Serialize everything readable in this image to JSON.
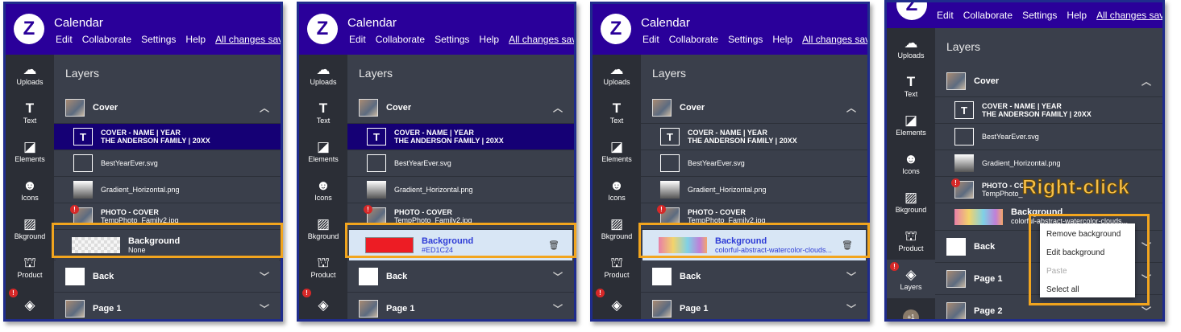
{
  "app": {
    "title": "Calendar",
    "logo": "Z",
    "menu": [
      "Edit",
      "Collaborate",
      "Settings",
      "Help"
    ],
    "saved": "All changes sav",
    "saved_full": "All changes saved"
  },
  "sidebar": [
    {
      "label": "Uploads",
      "icon": "cloud-upload-icon"
    },
    {
      "label": "Text",
      "icon": "text-icon"
    },
    {
      "label": "Elements",
      "icon": "elements-icon"
    },
    {
      "label": "Icons",
      "icon": "smiley-icon"
    },
    {
      "label": "Bkground",
      "icon": "hatch-icon"
    },
    {
      "label": "Product",
      "icon": "product-icon"
    },
    {
      "label": "Layers",
      "icon": "layers-icon"
    }
  ],
  "layers": {
    "heading": "Layers",
    "cover": "Cover",
    "text_layer": {
      "line1": "COVER - NAME | YEAR",
      "line2": "THE ANDERSON FAMILY | 20XX"
    },
    "svg_layer": "BestYearEver.svg",
    "gradient_layer": "Gradient_Horizontal.png",
    "photo_layer": {
      "line1": "PHOTO - COVER",
      "line2": "TempPhoto_Family2.jpg"
    },
    "photo_layer_p4": {
      "line1": "PHOTO - CO",
      "line2": "TempPhoto_"
    },
    "back": "Back",
    "page1": "Page 1",
    "page2": "Page 2"
  },
  "backgrounds": [
    {
      "label": "Background",
      "sub": "None",
      "color": "#3a3f4b"
    },
    {
      "label": "Background",
      "sub": "#ED1C24",
      "color": "#ED1C24"
    },
    {
      "label": "Background",
      "sub": "colorful-abstract-watercolor-clouds...",
      "color": "#d8e6f5"
    },
    {
      "label": "Background",
      "sub": "colorful-abstract-watercolor-clouds..."
    }
  ],
  "annotation": {
    "right_click": "Right-click",
    "badge_count": "+1",
    "highlight_color": "#f2a51e"
  },
  "context_menu": [
    {
      "label": "Remove background",
      "disabled": false
    },
    {
      "label": "Edit background",
      "disabled": false
    },
    {
      "label": "Paste",
      "disabled": true
    },
    {
      "label": "Select all",
      "disabled": false
    }
  ],
  "colors": {
    "topbar": "#2a009a",
    "panel_border": "#1f2c8c",
    "selected_row": "#150075",
    "selected_bg_row": "#d8e6f5"
  }
}
